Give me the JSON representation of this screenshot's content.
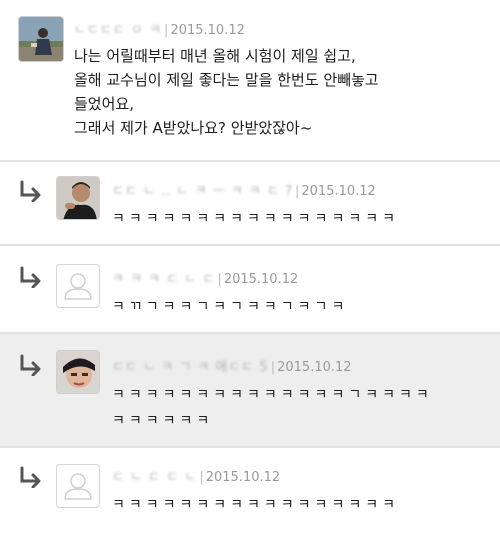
{
  "main_post": {
    "author": "ㄴㄷㄷㄷ ㅇ ㅋ",
    "date": "2015.10.12",
    "text": "나는 어릴때부터 매년 올해 시험이 제일 쉽고,\n올해 교수님이 제일 좋다는 말을 한번도 안빼놓고\n들었어요,\n그래서 제가 A받았나요? 안받았잖아~"
  },
  "replies": [
    {
      "author": "ㄷㄷ ㄴ .. ㄴ ㅋ ㅡ ㅋ ㅋ ㄷ ?",
      "date": "2015.10.12",
      "text": "ㅋㅋㅋㅋㅋㅋㅋㅋㅋㅋㅋㅋㅋㅋㅋㅋㅋ",
      "highlighted": false
    },
    {
      "author": "ㅋ ㅋ ㅋ ㄷ ㄴ ㄷ",
      "date": "2015.10.12",
      "text": "ㅋㄲㄱㅋㅋㄱㅋㄱㅋㅋㄱㅋㄱㅋ",
      "highlighted": false
    },
    {
      "author": "ㄷㄷ ㄴ ㅋ ㄱ ㅋ 애ㄷㄷ 5",
      "date": "2015.10.12",
      "text": "ㅋㅋㅋㅋㅋㅋㅋㅋㅋㅋㅋㅋㅋㅋㄱㅋㅋㅋㅋ\nㅋㅋㅋㅋㅋㅋ",
      "highlighted": true
    },
    {
      "author": "ㄷ ㄴ ㄷ ㄷ ㄴ",
      "date": "2015.10.12",
      "text": "ㅋㅋㅋㅋㅋㅋㅋㅋㅋㅋㅋㅋㅋㅋㅋㅋㅋ",
      "highlighted": false
    }
  ],
  "icons": {
    "reply_arrow": "reply-arrow-icon",
    "default_avatar": "default-user-icon"
  },
  "colors": {
    "highlight_bg": "#eeeeee",
    "divider": "#e2e2e2",
    "meta_text": "#9a9a9a"
  }
}
